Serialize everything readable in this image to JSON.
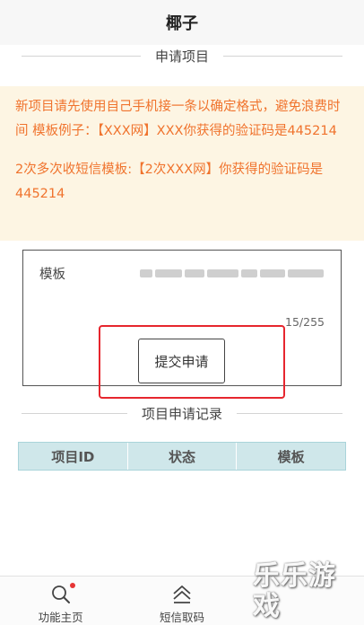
{
  "header": {
    "title": "椰子"
  },
  "apply_section": {
    "title": "申请项目"
  },
  "notice": {
    "paragraph1": "新项目请先使用自己手机接一条以确定格式，避免浪费时间 模板例子：【XXX网】XXX你获得的验证码是445214",
    "paragraph2": "2次多次收短信模板:【2次XXX网】你获得的验证码是445214"
  },
  "form": {
    "template_label": "模板",
    "counter": "15/255",
    "submit_label": "提交申请"
  },
  "records_section": {
    "title": "项目申请记录"
  },
  "table": {
    "headers": [
      "项目ID",
      "状态",
      "模板"
    ]
  },
  "bottom_nav": {
    "items": [
      {
        "label": "功能主页",
        "icon": "search-icon"
      },
      {
        "label": "短信取码",
        "icon": "home-icon"
      }
    ]
  },
  "watermark": {
    "text": "乐乐游戏"
  },
  "colors": {
    "notice_bg": "#fdf5e3",
    "notice_text": "#f0732d",
    "table_header_bg": "#cfe7ea",
    "highlight": "#e6262e"
  }
}
